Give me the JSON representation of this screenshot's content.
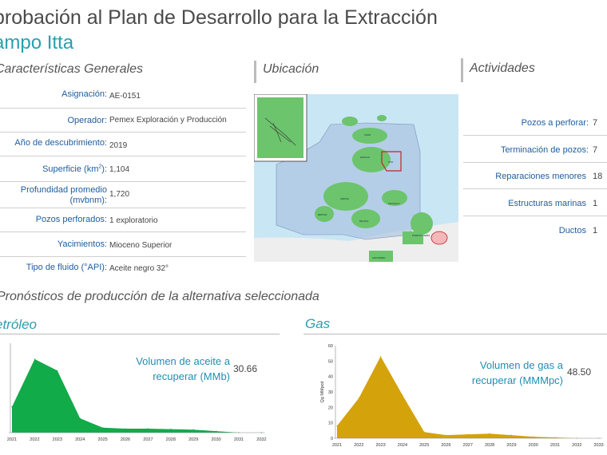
{
  "header": {
    "title": "probación al Plan de Desarrollo para la Extracción",
    "subtitle": "ampo Itta"
  },
  "sections": {
    "general": "Características Generales",
    "location": "Ubicación",
    "activities": "Actividades",
    "forecast": "Pronósticos de producción de la alternativa seleccionada"
  },
  "general_rows": [
    {
      "label": "Asignación:",
      "value": "AE-0151"
    },
    {
      "label": "Operador:",
      "value": "Pemex Exploración y Producción"
    },
    {
      "label": "Año de descubrimiento:",
      "value": "2019"
    },
    {
      "label": "Superficie (km²):",
      "value": "1,104"
    },
    {
      "label": "Profundidad promedio (mvbnm):",
      "value": "1,720"
    },
    {
      "label": "Pozos perforados:",
      "value": "1 exploratorio"
    },
    {
      "label": "Yacimientos:",
      "value": "Mioceno Superior"
    },
    {
      "label": "Tipo de fluido (°API):",
      "value": "Aceite negro 32°"
    }
  ],
  "activities": [
    {
      "label": "Pozos a perforar:",
      "value": "7"
    },
    {
      "label": "Terminación de pozos:",
      "value": "7"
    },
    {
      "label": "Reparaciones menores",
      "value": "18"
    },
    {
      "label": "Estructuras marinas",
      "value": "1"
    },
    {
      "label": "Ductos",
      "value": "1"
    }
  ],
  "map": {
    "labels": [
      "HOKCHI",
      "ITTA",
      "XAAN",
      "AMOCA",
      "TECOALLI",
      "MILOSA",
      "MIZTON",
      "PUERTO CEIBA",
      "CHILTEPEC"
    ],
    "colors": {
      "water": "#c9e6f5",
      "block": "#a7bedd",
      "field": "#6cc46c",
      "land": "#eeeeee",
      "highlight": "#c8202a"
    }
  },
  "chart_data": [
    {
      "type": "area",
      "title": "etróleo",
      "annotation_label": "Volumen de aceite a recuperar (MMb)",
      "annotation_value": "30.66",
      "color": "#12ab4a",
      "x": [
        "2021",
        "2022",
        "2023",
        "2024",
        "2025",
        "2026",
        "2027",
        "2028",
        "2029",
        "2030",
        "2031",
        "2032"
      ],
      "series": [
        {
          "values": [
            5.2,
            14.8,
            12.5,
            2.9,
            1.0,
            0.8,
            0.8,
            0.7,
            0.6,
            0.3,
            0.0,
            0.0
          ]
        }
      ],
      "ylim": [
        0,
        18
      ],
      "xlabel": "",
      "ylabel": ""
    },
    {
      "type": "area",
      "title": "Gas",
      "annotation_label": "Volumen de gas a recuperar (MMMpc)",
      "annotation_value": "48.50",
      "color": "#d4a20b",
      "x": [
        "2021",
        "2022",
        "2023",
        "2024",
        "2025",
        "2026",
        "2027",
        "2028",
        "2029",
        "2030",
        "2031",
        "2032",
        "2033"
      ],
      "series": [
        {
          "values": [
            8,
            26,
            53,
            28,
            4,
            2,
            2.5,
            3,
            2,
            1,
            0.5,
            0,
            0
          ]
        }
      ],
      "yticks": [
        0,
        10,
        20,
        30,
        40,
        50,
        60
      ],
      "ylim": [
        0,
        60
      ],
      "ylabel": "Qg MMpcd",
      "xlabel": ""
    }
  ]
}
